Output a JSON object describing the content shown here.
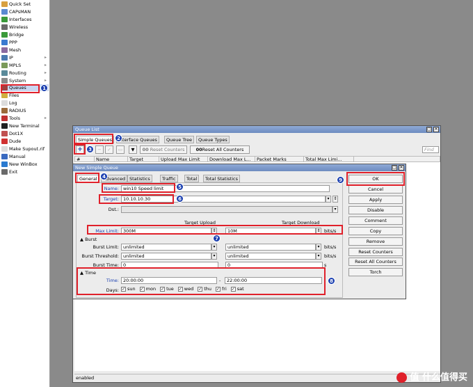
{
  "sidebar": {
    "items": [
      {
        "label": "Quick Set",
        "icon": "quick-set-icon",
        "color": "#d8a040"
      },
      {
        "label": "CAPsMAN",
        "icon": "capsman-icon",
        "color": "#5a8ad0"
      },
      {
        "label": "Interfaces",
        "icon": "interfaces-icon",
        "color": "#3a9a3a"
      },
      {
        "label": "Wireless",
        "icon": "wireless-icon",
        "color": "#6a6a6a"
      },
      {
        "label": "Bridge",
        "icon": "bridge-icon",
        "color": "#3a9a3a"
      },
      {
        "label": "PPP",
        "icon": "ppp-icon",
        "color": "#3a7ad0"
      },
      {
        "label": "Mesh",
        "icon": "mesh-icon",
        "color": "#8a6aa0"
      },
      {
        "label": "IP",
        "icon": "ip-icon",
        "color": "#4a7ab0"
      },
      {
        "label": "MPLS",
        "icon": "mpls-icon",
        "color": "#7a9a5a"
      },
      {
        "label": "Routing",
        "icon": "routing-icon",
        "color": "#5a8a9a"
      },
      {
        "label": "System",
        "icon": "system-icon",
        "color": "#8a8a8a"
      },
      {
        "label": "Queues",
        "icon": "queues-icon",
        "color": "#a04040"
      },
      {
        "label": "Files",
        "icon": "files-icon",
        "color": "#d0b040"
      },
      {
        "label": "Log",
        "icon": "log-icon",
        "color": "#dcdcdc"
      },
      {
        "label": "RADIUS",
        "icon": "radius-icon",
        "color": "#9a6a3a"
      },
      {
        "label": "Tools",
        "icon": "tools-icon",
        "color": "#c03030"
      },
      {
        "label": "New Terminal",
        "icon": "terminal-icon",
        "color": "#202020"
      },
      {
        "label": "Dot1X",
        "icon": "dot1x-icon",
        "color": "#c05050"
      },
      {
        "label": "Dude",
        "icon": "dude-icon",
        "color": "#d03030"
      },
      {
        "label": "Make Supout.rif",
        "icon": "supout-icon",
        "color": "#dcdcdc"
      },
      {
        "label": "Manual",
        "icon": "manual-icon",
        "color": "#3a6ac0"
      },
      {
        "label": "New WinBox",
        "icon": "winbox-icon",
        "color": "#2a7ad0"
      },
      {
        "label": "Exit",
        "icon": "exit-icon",
        "color": "#6a6a6a"
      }
    ],
    "arrows": [
      "IP",
      "MPLS",
      "Routing",
      "System",
      "Tools"
    ]
  },
  "queue_list": {
    "title": "Queue List",
    "tabs": [
      "Simple Queues",
      "Interface Queues",
      "Queue Tree",
      "Queue Types"
    ],
    "toolbar": {
      "reset_counters": "Reset Counters",
      "reset_all_counters": "Reset All Counters",
      "find": "Find",
      "oo1": "00",
      "oo2": "00"
    },
    "columns": [
      "#",
      "Name",
      "Target",
      "Upload Max Limit",
      "Download Max L...",
      "Packet Marks",
      "Total Max Limi..."
    ],
    "status": "enabled"
  },
  "dialog": {
    "title": "New Simple Queue",
    "tabs": [
      "General",
      "Advanced",
      "Statistics",
      "Traffic",
      "Total",
      "Total Statistics"
    ],
    "fields": {
      "name_label": "Name:",
      "name_value": "win10 Speed limit",
      "target_label": "Target:",
      "target_value": "10.10.10.30",
      "dst_label": "Dst.:",
      "target_upload": "Target Upload",
      "target_download": "Target Download",
      "max_limit_label": "Max Limit:",
      "max_limit_up": "300M",
      "max_limit_down": "10M",
      "unit_bits": "bits/s",
      "burst_section": "Burst",
      "burst_limit_label": "Burst Limit:",
      "burst_limit_up": "unlimited",
      "burst_limit_down": "unlimited",
      "burst_threshold_label": "Burst Threshold:",
      "burst_threshold_up": "unlimited",
      "burst_threshold_down": "unlimited",
      "burst_time_label": "Burst Time:",
      "burst_time_up": "0",
      "burst_time_down": "0",
      "unit_s": "s",
      "time_section": "Time",
      "time_label": "Time:",
      "time_from": "20:00:00",
      "time_sep": "-",
      "time_to": "22:00:00",
      "days_label": "Days:",
      "days": [
        "sun",
        "mon",
        "tue",
        "wed",
        "thu",
        "fri",
        "sat"
      ]
    },
    "buttons": [
      "OK",
      "Cancel",
      "Apply",
      "Disable",
      "Comment",
      "Copy",
      "Remove",
      "Reset Counters",
      "Reset All Counters",
      "Torch"
    ]
  },
  "badges": [
    "1",
    "2",
    "3",
    "4",
    "5",
    "6",
    "7",
    "8",
    "9"
  ],
  "watermark": "值 什么值得买",
  "colors": {
    "annotation_red": "#e0202a",
    "badge_blue": "#1a3fb0",
    "titlebar": "#7d99cb"
  }
}
